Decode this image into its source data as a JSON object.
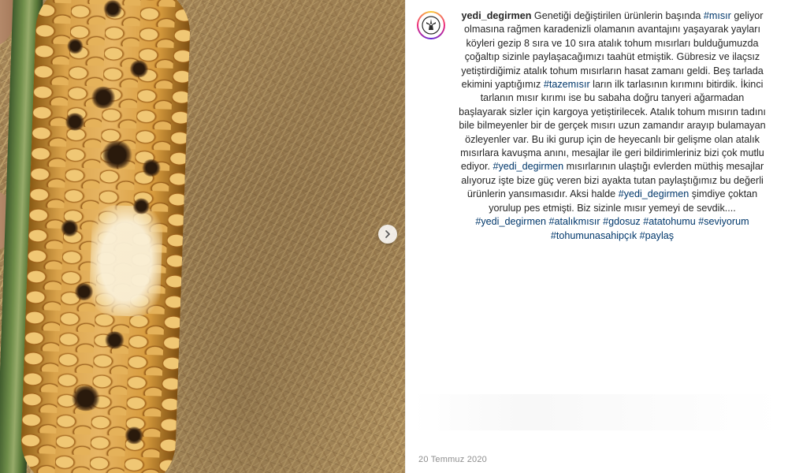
{
  "post": {
    "username": "yedi_degirmen",
    "avatar_icon": "windmill-logo-icon",
    "caption_segments": [
      {
        "text": "Genetiği değiştirilen ürünlerin başında ",
        "type": "text"
      },
      {
        "text": "#mısır",
        "type": "tag"
      },
      {
        "text": " geliyor olmasına rağmen karadenizli olamanın avantajını yaşayarak yayları köyleri gezip 8 sıra ve 10 sıra atalık tohum mısırları bulduğumuzda çoğaltıp sizinle paylaşacağımızı taahüt etmiştik. Gübresiz ve ilaçsız yetiştirdiğimiz atalık tohum mısırların hasat zamanı geldi. Beş tarlada ekimini yaptığımız ",
        "type": "text"
      },
      {
        "text": "#tazemısır",
        "type": "tag"
      },
      {
        "text": " ların ilk tarlasının kırımını bitirdik. İkinci tarlanın mısır kırımı ise bu sabaha doğru tanyeri ağarmadan başlayarak sizler için kargoya yetiştirilecek. Atalık tohum mısırın tadını bile bilmeyenler bir de gerçek mısırı uzun zamandır arayıp bulamayan özleyenler var. Bu iki gurup için de heyecanlı bir gelişme olan atalık mısırlara kavuşma anını, mesajlar ile geri bildirimleriniz bizi çok mutlu ediyor. ",
        "type": "text"
      },
      {
        "text": "#yedi_degirmen",
        "type": "tag"
      },
      {
        "text": " mısırlarının ulaştığı evlerden müthiş mesajlar alıyoruz işte bize güç veren bizi ayakta tutan paylaştığımız bu değerli ürünlerin yansımasıdır. Aksi halde ",
        "type": "text"
      },
      {
        "text": "#yedi_degirmen",
        "type": "tag"
      },
      {
        "text": " şimdiye çoktan yorulup pes etmişti. Biz sizinle mısır yemeyi de sevdik....",
        "type": "text"
      }
    ],
    "hashtags": [
      "#yedi_degirmen",
      "#atalıkmısır",
      "#gdosuz",
      "#atatohumu",
      "#seviyorum",
      "#tohumunasahipçık",
      "#paylaş"
    ],
    "date": "20 Temmuz 2020"
  },
  "media": {
    "next_icon": "chevron-right-icon",
    "description_icon": "corn-photo"
  },
  "colors": {
    "link": "#00376b",
    "text": "#262626",
    "muted": "#8e8e8e"
  }
}
